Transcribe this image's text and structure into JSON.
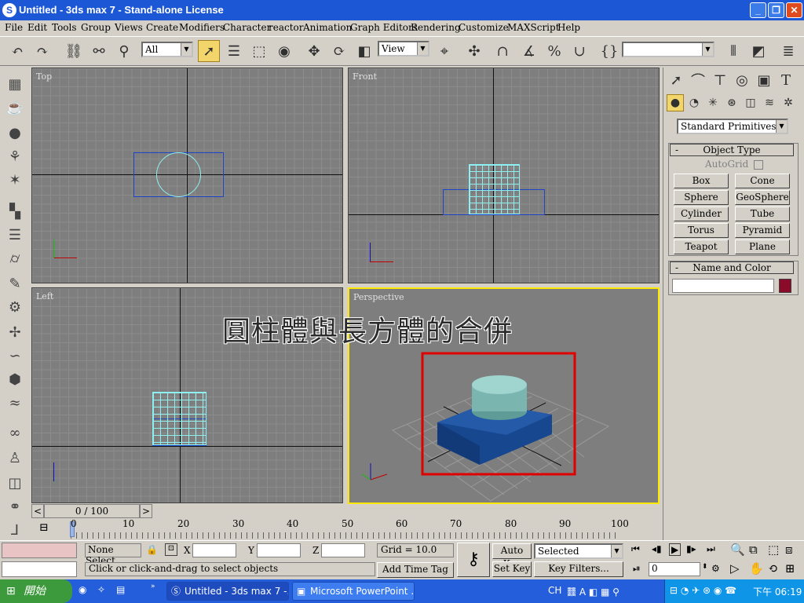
{
  "window": {
    "title": "Untitled - 3ds max 7  - Stand-alone License"
  },
  "menu": [
    "File",
    "Edit",
    "Tools",
    "Group",
    "Views",
    "Create",
    "Modifiers",
    "Character",
    "reactor",
    "Animation",
    "Graph Editors",
    "Rendering",
    "Customize",
    "MAXScript",
    "Help"
  ],
  "toolbar": {
    "selection_filter": "All",
    "ref_coord": "View",
    "named_sel": ""
  },
  "viewports": {
    "top": "Top",
    "front": "Front",
    "left": "Left",
    "perspective": "Perspective"
  },
  "overlay_caption": "圓柱體與長方體的合併",
  "command_panel": {
    "dropdown": "Standard Primitives",
    "object_type_title": "Object Type",
    "autogrid": "AutoGrid",
    "buttons": [
      "Box",
      "Cone",
      "Sphere",
      "GeoSphere",
      "Cylinder",
      "Tube",
      "Torus",
      "Pyramid",
      "Teapot",
      "Plane"
    ],
    "name_color_title": "Name and Color",
    "name_value": "",
    "color": "#8b0a2a"
  },
  "timeline": {
    "frame": "0 / 100",
    "ticks": [
      "0",
      "10",
      "20",
      "30",
      "40",
      "50",
      "60",
      "70",
      "80",
      "90",
      "100"
    ]
  },
  "status": {
    "selection": "None Select",
    "x_label": "X",
    "y_label": "Y",
    "z_label": "Z",
    "grid": "Grid = 10.0",
    "prompt": "Click or click-and-drag to select objects",
    "add_time_tag": "Add Time Tag",
    "auto_key": "Auto Key",
    "set_key": "Set Key",
    "key_mode": "Selected",
    "key_filters": "Key Filters...",
    "frame_field": "0"
  },
  "taskbar": {
    "start": "開始",
    "tasks": [
      "Untitled - 3ds max 7  -...",
      "Microsoft PowerPoint ..."
    ],
    "lang": "CH",
    "clock": "下午 06:19"
  }
}
